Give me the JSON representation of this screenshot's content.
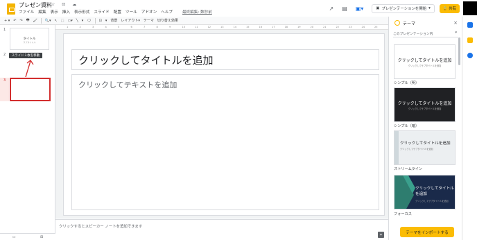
{
  "app": {
    "title": "プレゼン資料",
    "title_icons": "☆ ⊡ ☁",
    "menu": [
      "ファイル",
      "編集",
      "表示",
      "挿入",
      "表示形式",
      "スライド",
      "配置",
      "ツール",
      "アドオン",
      "ヘルプ"
    ],
    "last_edit": "最終編集: 数秒前"
  },
  "header": {
    "present_label": "プレゼンテーションを開始",
    "share_label": "🔒 共有",
    "icons": [
      "trend-icon",
      "comment-icon",
      "meet-icon"
    ]
  },
  "toolbar": {
    "items": [
      "+ ▾",
      "↶",
      "↷",
      "🖶",
      "🖌",
      "🔍▾",
      "↖",
      "⬚",
      "▭▾",
      "╲",
      "▾",
      "🗨",
      "⊡",
      "▾",
      "背景",
      "レイアウト▾",
      "テーマ",
      "切り替え効果"
    ]
  },
  "filmstrip": {
    "slide1_num": "1",
    "slide1_title": "タイトル",
    "slide1_sub": "サブタイトル",
    "slide2_num": "2",
    "slide3_num": "3",
    "tooltip": "スライド１枚を移動"
  },
  "ruler": [
    "1",
    "2",
    "3",
    "4",
    "5",
    "6",
    "7",
    "8",
    "9",
    "10",
    "11",
    "12",
    "13",
    "14",
    "15",
    "16",
    "17",
    "18",
    "19",
    "20",
    "21",
    "22",
    "23",
    "24",
    "25"
  ],
  "slide": {
    "title_placeholder": "クリックしてタイトルを追加",
    "body_placeholder": "クリックしてテキストを追加"
  },
  "notes": {
    "placeholder": "クリックするとスピーカー ノートを追加できます"
  },
  "bottom_left": [
    "▭",
    "⊞"
  ],
  "theme_panel": {
    "title": "テーマ",
    "close": "×",
    "select_label": "このプレゼンテーション内",
    "themes": [
      {
        "name": "シンプル（明）",
        "title": "クリックしてタイトルを追加",
        "sub": "クリックしてサブタイトルを追加"
      },
      {
        "name": "シンプル（暗）",
        "title": "クリックしてタイトルを追加",
        "sub": "クリックしてサブタイトルを追加"
      },
      {
        "name": "ストリームライン",
        "title": "クリックしてタイトルを追加",
        "sub": "クリックしてサブタイトルを追加"
      },
      {
        "name": "フォーカス",
        "title": "クリックしてタイトルを追加",
        "sub": "クリックしてサブタイトルを追加"
      }
    ],
    "import_label": "テーマをインポートする"
  },
  "colors": {
    "accent": "#fbbc04",
    "drop_border": "#d32f2f",
    "dark_theme": "#202124",
    "focus_theme": "#1a2a4a"
  }
}
